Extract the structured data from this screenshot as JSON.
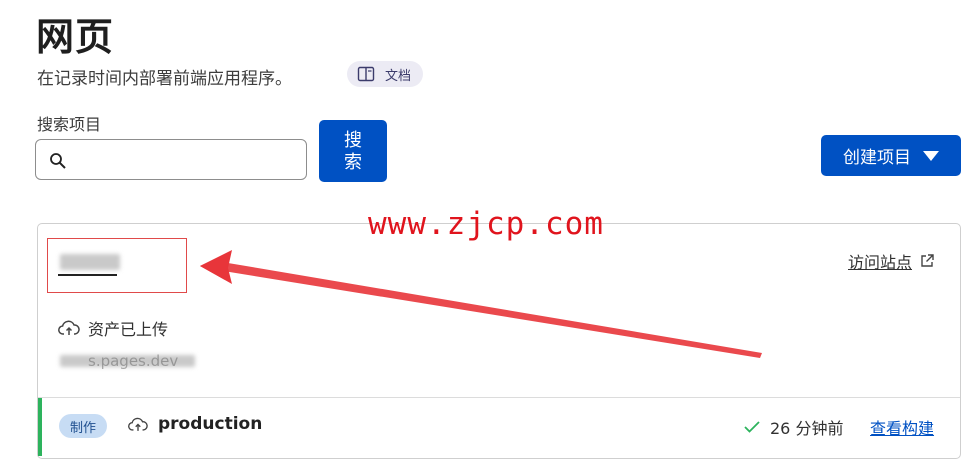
{
  "header": {
    "title": "网页",
    "subtitle": "在记录时间内部署前端应用程序。",
    "docs_label": "文档"
  },
  "search": {
    "label": "搜索项目",
    "value": "",
    "placeholder": "",
    "button_label": "搜索"
  },
  "create_button": {
    "label": "创建项目"
  },
  "watermark": "www.zjcp.com",
  "project_card": {
    "visit_site_label": "访问站点",
    "assets_status": "资产已上传",
    "url_visible_fragment": "s.pages.dev",
    "deployment": {
      "environment_badge": "制作",
      "branch": "production",
      "time_ago": "26 分钟前",
      "view_build_label": "查看构建",
      "status": "success"
    }
  },
  "colors": {
    "primary": "#0051c3",
    "badge_bg": "#c7dcf4",
    "success": "#2db35d",
    "annotation_red": "#e0141d"
  },
  "icons": [
    "docs-book-icon",
    "search-icon",
    "caret-down-icon",
    "external-link-icon",
    "cloud-upload-icon",
    "checkmark-icon"
  ]
}
